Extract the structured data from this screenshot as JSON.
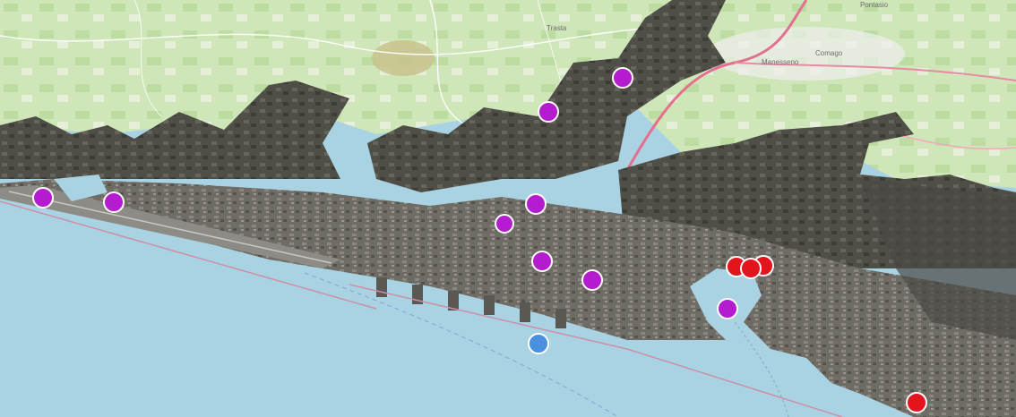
{
  "map": {
    "view": "3d-terrain-satellite",
    "colors": {
      "sea": "#a9d3e3",
      "land": "#cfe6b8",
      "terrain": "#5a5a52",
      "urban": "#6d6a63",
      "motorway": "#e46f8f",
      "poi_purple": "#b51ccf",
      "poi_red": "#e3141b",
      "location_blue": "#4a8fe0"
    },
    "labels": [
      "Trasta",
      "Manesseno",
      "Comago",
      "Pontasio"
    ],
    "markers": [
      {
        "id": "purple-1",
        "color": "poi_purple",
        "type": "poi"
      },
      {
        "id": "purple-2",
        "color": "poi_purple",
        "type": "poi"
      },
      {
        "id": "purple-3",
        "color": "poi_purple",
        "type": "poi"
      },
      {
        "id": "purple-4",
        "color": "poi_purple",
        "type": "poi"
      },
      {
        "id": "purple-5",
        "color": "poi_purple",
        "type": "poi"
      },
      {
        "id": "purple-6",
        "color": "poi_purple",
        "type": "poi"
      },
      {
        "id": "purple-7",
        "color": "poi_purple",
        "type": "poi"
      },
      {
        "id": "purple-8",
        "color": "poi_purple",
        "type": "poi"
      },
      {
        "id": "purple-9",
        "color": "poi_purple",
        "type": "poi"
      },
      {
        "id": "red-1",
        "color": "poi_red",
        "type": "poi"
      },
      {
        "id": "red-2",
        "color": "poi_red",
        "type": "poi"
      },
      {
        "id": "red-3",
        "color": "poi_red",
        "type": "poi"
      },
      {
        "id": "red-4",
        "color": "poi_red",
        "type": "poi"
      },
      {
        "id": "blue-location",
        "color": "location_blue",
        "type": "current-location"
      }
    ]
  }
}
